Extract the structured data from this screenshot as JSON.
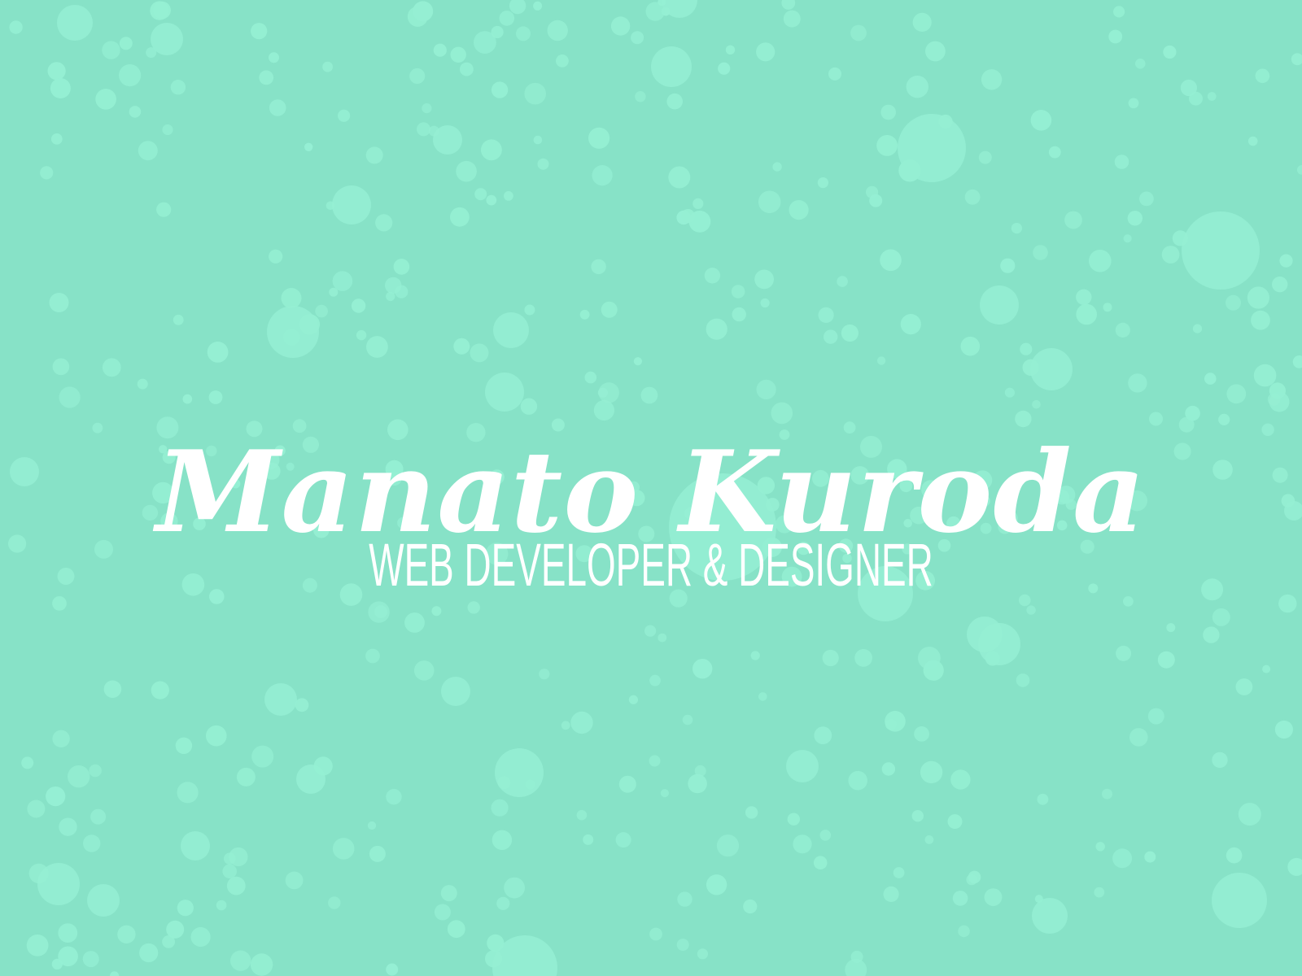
{
  "hero": {
    "name": "Manato Kuroda",
    "tagline": "WEB DEVELOPER & DESIGNER"
  },
  "colors": {
    "background": "#87e2c7",
    "bubble": "#95efd3",
    "text": "#ffffff"
  }
}
